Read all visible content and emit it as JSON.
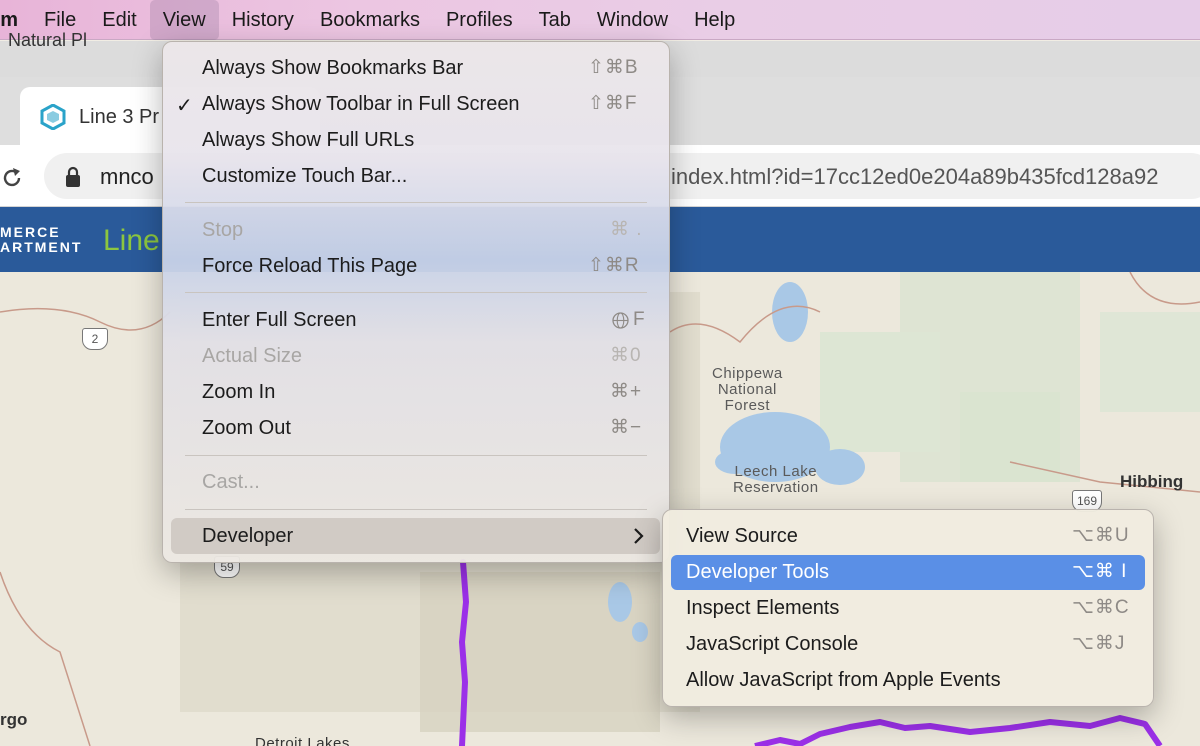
{
  "menubar": {
    "app": "um",
    "items": [
      "File",
      "Edit",
      "View",
      "History",
      "Bookmarks",
      "Profiles",
      "Tab",
      "Window",
      "Help"
    ],
    "active": "View"
  },
  "browser": {
    "bookmark_fragment": "Natural Pl",
    "tab_title": "Line 3 Pr",
    "url_left": "mnco",
    "url_right": "index.html?id=17cc12ed0e204a89b435fcd128a92"
  },
  "page": {
    "org_line1": "MERCE",
    "org_line2": "ARTMENT",
    "title": "Line",
    "header_color": "#2a5a9a",
    "title_color": "#8cc63f"
  },
  "map": {
    "labels": {
      "chippewa": "Chippewa\nNational\nForest",
      "leech": "Leech Lake\nReservation",
      "hibbing": "Hibbing",
      "fargo": "rgo",
      "detroit": "Detroit Lakes"
    },
    "shields": [
      "2",
      "169",
      "59"
    ],
    "route_color": "#9b30e8"
  },
  "view_menu": {
    "items": [
      {
        "label": "Always Show Bookmarks Bar",
        "shortcut": "⇧⌘B",
        "checked": false,
        "disabled": false
      },
      {
        "label": "Always Show Toolbar in Full Screen",
        "shortcut": "⇧⌘F",
        "checked": true,
        "disabled": false
      },
      {
        "label": "Always Show Full URLs",
        "shortcut": "",
        "checked": false,
        "disabled": false
      },
      {
        "label": "Customize Touch Bar...",
        "shortcut": "",
        "checked": false,
        "disabled": false
      },
      {
        "label": "Stop",
        "shortcut": "⌘ .",
        "checked": false,
        "disabled": true
      },
      {
        "label": "Force Reload This Page",
        "shortcut": "⇧⌘R",
        "checked": false,
        "disabled": false
      },
      {
        "label": "Enter Full Screen",
        "shortcut": "F",
        "checked": false,
        "disabled": false,
        "shortcut_icon": "globe-icon"
      },
      {
        "label": "Actual Size",
        "shortcut": "⌘0",
        "checked": false,
        "disabled": true
      },
      {
        "label": "Zoom In",
        "shortcut": "⌘+",
        "checked": false,
        "disabled": false
      },
      {
        "label": "Zoom Out",
        "shortcut": "⌘−",
        "checked": false,
        "disabled": false
      },
      {
        "label": "Cast...",
        "shortcut": "",
        "checked": false,
        "disabled": true
      },
      {
        "label": "Developer",
        "shortcut": "",
        "checked": false,
        "disabled": false,
        "submenu": true,
        "highlighted": true
      }
    ]
  },
  "developer_menu": {
    "items": [
      {
        "label": "View Source",
        "shortcut": "⌥⌘U"
      },
      {
        "label": "Developer Tools",
        "shortcut": "⌥⌘ I",
        "selected": true
      },
      {
        "label": "Inspect Elements",
        "shortcut": "⌥⌘C"
      },
      {
        "label": "JavaScript Console",
        "shortcut": "⌥⌘J"
      },
      {
        "label": "Allow JavaScript from Apple Events",
        "shortcut": ""
      }
    ],
    "selected_color": "#5a8fe6"
  }
}
